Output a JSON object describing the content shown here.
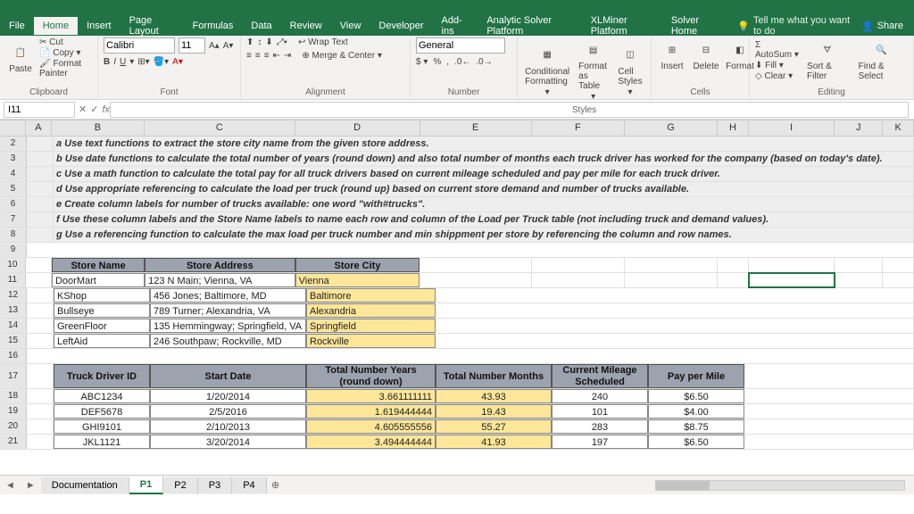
{
  "app": {
    "cell_ref": "I11"
  },
  "tabs": [
    "File",
    "Home",
    "Insert",
    "Page Layout",
    "Formulas",
    "Data",
    "Review",
    "View",
    "Developer",
    "Add-ins",
    "Analytic Solver Platform",
    "XLMiner Platform",
    "Solver Home"
  ],
  "tellme": "Tell me what you want to do",
  "share": "Share",
  "ribbon": {
    "clipboard": {
      "label": "Clipboard",
      "paste": "Paste",
      "cut": "Cut",
      "copy": "Copy",
      "painter": "Format Painter"
    },
    "font": {
      "label": "Font",
      "name": "Calibri",
      "size": "11"
    },
    "alignment": {
      "label": "Alignment",
      "wrap": "Wrap Text",
      "merge": "Merge & Center"
    },
    "number": {
      "label": "Number",
      "format": "General"
    },
    "styles": {
      "label": "Styles",
      "cond": "Conditional Formatting",
      "fmtas": "Format as Table",
      "cell": "Cell Styles"
    },
    "cells": {
      "label": "Cells",
      "insert": "Insert",
      "delete": "Delete",
      "format": "Format"
    },
    "editing": {
      "label": "Editing",
      "autosum": "AutoSum",
      "fill": "Fill",
      "clear": "Clear",
      "sort": "Sort & Filter",
      "find": "Find & Select"
    }
  },
  "cols": [
    "A",
    "B",
    "C",
    "D",
    "E",
    "F",
    "G",
    "H",
    "I",
    "J",
    "K"
  ],
  "instructions": {
    "a": "a  Use text functions to extract the store city name from the given store address.",
    "b": "b  Use date functions to calculate the total number of years (round down) and also total number of months each truck driver has worked for the company (based on today's date).",
    "c": "c  Use a math function to calculate the total pay for all truck drivers based on current mileage scheduled and pay per mile for each truck driver.",
    "d": "d  Use appropriate referencing to calculate the load per truck (round up) based on current store demand and number of trucks available.",
    "e": "e  Create column labels for number of trucks available: one word \"with#trucks\".",
    "f": "f  Use these column labels and the Store Name labels to name each row and column of the Load per Truck table (not including truck and demand values).",
    "g": "g  Use a referencing function to calculate the max load per truck number and min shippment per store by referencing the column and row names."
  },
  "stores": {
    "headers": {
      "name": "Store Name",
      "addr": "Store Address",
      "city": "Store City"
    },
    "rows": [
      {
        "name": "DoorMart",
        "addr": "123 N Main; Vienna, VA",
        "city": "Vienna"
      },
      {
        "name": "KShop",
        "addr": "456 Jones; Baltimore, MD",
        "city": "Baltimore"
      },
      {
        "name": "Bullseye",
        "addr": "789 Turner; Alexandria, VA",
        "city": "Alexandria"
      },
      {
        "name": "GreenFloor",
        "addr": "135 Hemmingway; Springfield, VA",
        "city": "Springfield"
      },
      {
        "name": "LeftAid",
        "addr": "246 Southpaw; Rockville, MD",
        "city": "Rockville"
      }
    ]
  },
  "drivers": {
    "headers": {
      "id": "Truck Driver ID",
      "start": "Start Date",
      "years": "Total Number Years (round down)",
      "months": "Total Number Months",
      "mileage": "Current Mileage Scheduled",
      "pay": "Pay per Mile"
    },
    "rows": [
      {
        "id": "ABC1234",
        "start": "1/20/2014",
        "years": "3.661111111",
        "months": "43.93",
        "mileage": "240",
        "pay": "$6.50"
      },
      {
        "id": "DEF5678",
        "start": "2/5/2016",
        "years": "1.619444444",
        "months": "19.43",
        "mileage": "101",
        "pay": "$4.00"
      },
      {
        "id": "GHI9101",
        "start": "2/10/2013",
        "years": "4.605555556",
        "months": "55.27",
        "mileage": "283",
        "pay": "$8.75"
      },
      {
        "id": "JKL1121",
        "start": "3/20/2014",
        "years": "3.494444444",
        "months": "41.93",
        "mileage": "197",
        "pay": "$6.50"
      }
    ]
  },
  "sheets": {
    "doc": "Documentation",
    "p1": "P1",
    "p2": "P2",
    "p3": "P3",
    "p4": "P4"
  }
}
